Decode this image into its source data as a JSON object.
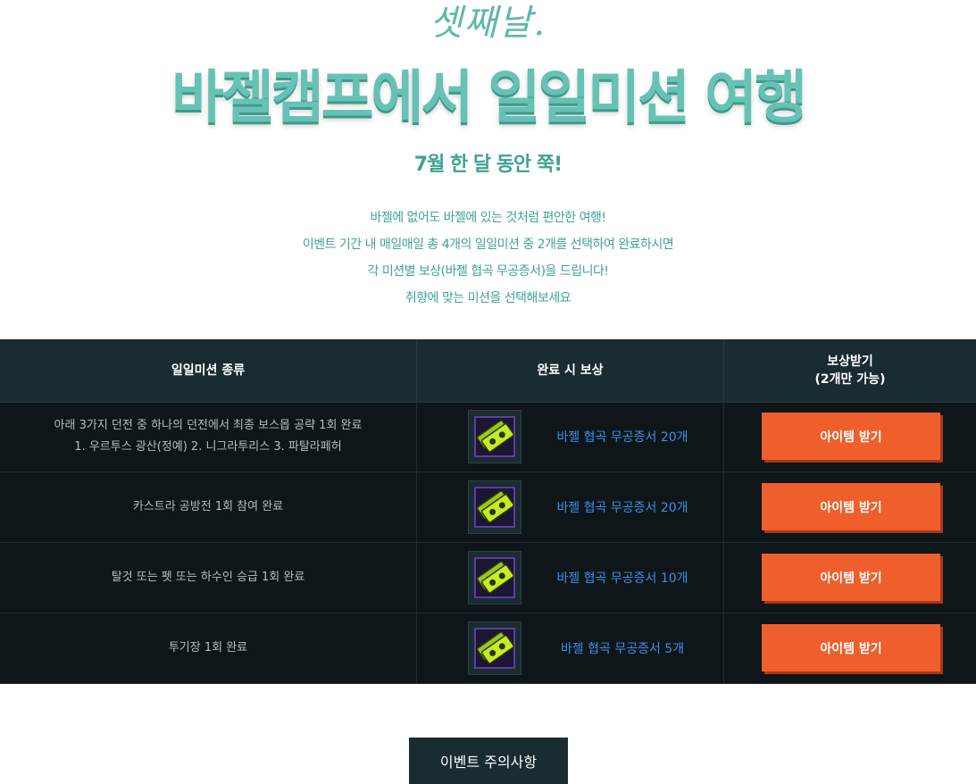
{
  "header": {
    "script_title": "셋째날.",
    "main_title": "바젤캠프에서 일일미션 여행",
    "subtitle": "7월 한 달 동안 쭉!",
    "description_lines": [
      "바젤에 없어도 바젤에 있는 것처럼 편안한 여행!",
      "이벤트 기간 내 매일매일 총 4개의 일일미션 중 2개를 선택하여 완료하시면",
      "각 미션별 보상(바젤 협곡 무공증서)을 드립니다!",
      "취향에 맞는 미션을 선택해보세요"
    ]
  },
  "table": {
    "headers": {
      "mission": "일일미션 종류",
      "reward": "완료 시 보상",
      "claim_line1": "보상받기",
      "claim_line2": "(2개만 가능)"
    },
    "rows": [
      {
        "mission_line1": "아래 3가지 던전 중 하나의 던전에서 최종 보스몹 공략 1회 완료",
        "mission_line2": "1. 우르투스 광산(정예)  2. 니그라투리스  3. 파탈라페허",
        "reward": "바젤 협곡 무공증서 20개",
        "reward_icon": "voucher-icon",
        "button": "아이템 받기"
      },
      {
        "mission_line1": "카스트라 공방전 1회 참여 완료",
        "reward": "바젤 협곡 무공증서 20개",
        "reward_icon": "voucher-icon",
        "button": "아이템 받기"
      },
      {
        "mission_line1": "탈것 또는 펫 또는 하수인 승급 1회 완료",
        "reward": "바젤 협곡 무공증서 10개",
        "reward_icon": "voucher-icon",
        "button": "아이템 받기"
      },
      {
        "mission_line1": "투기장 1회 완료",
        "reward": "바젤 협곡 무공증서 5개",
        "reward_icon": "voucher-icon",
        "button": "아이템 받기"
      }
    ]
  },
  "footer": {
    "notice_button": "이벤트 주의사항"
  },
  "colors": {
    "title_teal": "#66c2b4",
    "text_teal": "#3fa393",
    "table_bg": "#0f1619",
    "header_bg": "#1a2b31",
    "button_orange": "#ef5f2b",
    "reward_blue": "#3c8fe6"
  }
}
